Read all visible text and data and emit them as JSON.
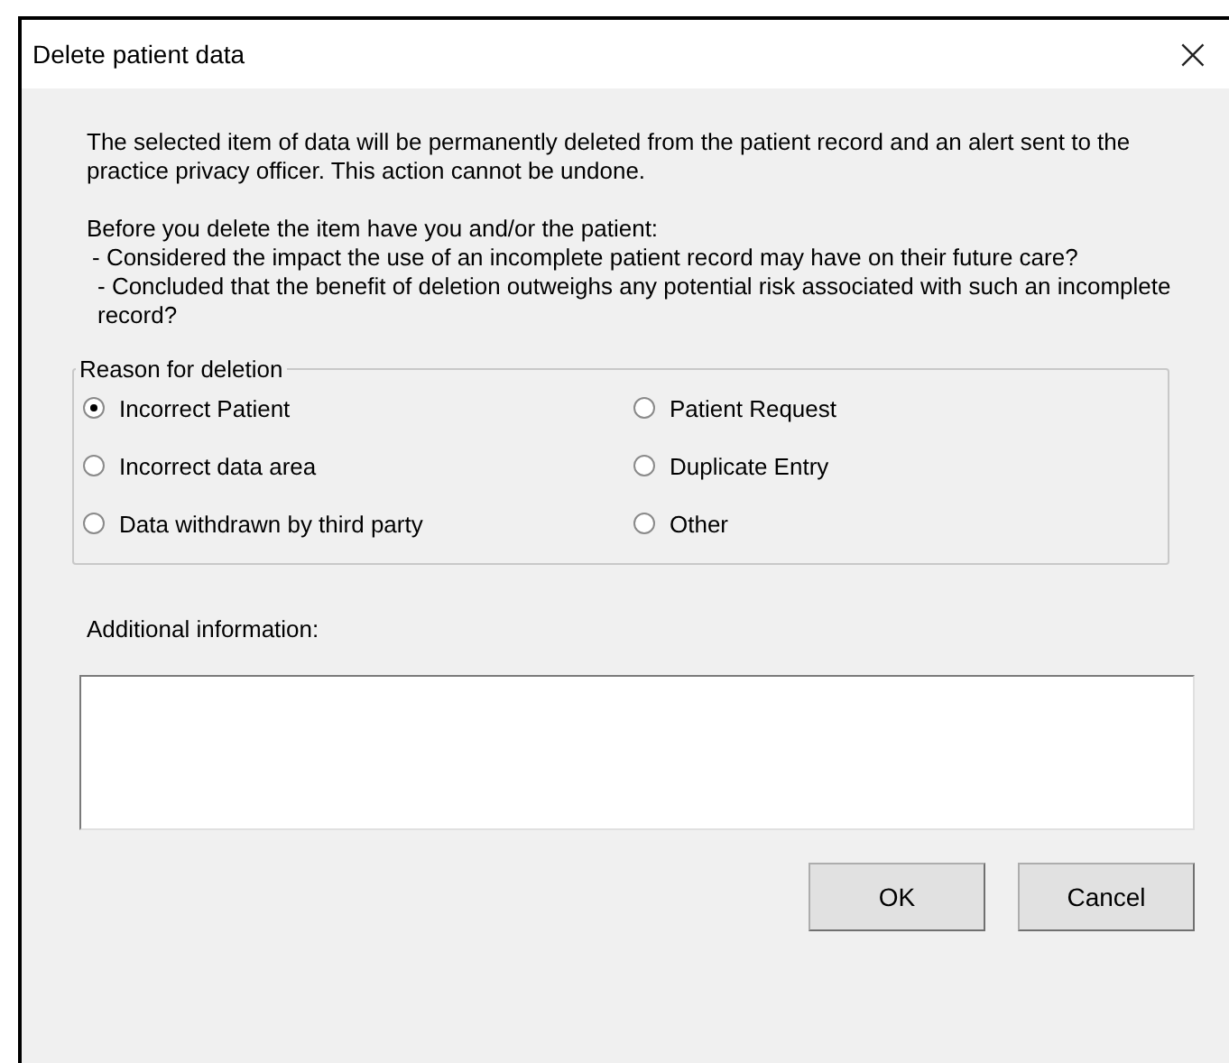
{
  "window": {
    "title": "Delete patient data",
    "close": "×"
  },
  "intro": "The selected item of data will be permanently deleted from the patient record and an alert sent to the practice privacy officer. This action cannot be undone.",
  "question": "Before you delete the item have you and/or the patient:",
  "checks": [
    "- Considered the impact the use of an incomplete patient record may have on their future care?",
    "- Concluded that the benefit of deletion outweighs any potential risk associated with such an incomplete record?"
  ],
  "reason_group": {
    "title": "Reason for deletion",
    "options": [
      {
        "label": "Incorrect Patient",
        "selected": true
      },
      {
        "label": "Patient Request",
        "selected": false
      },
      {
        "label": "Incorrect data area",
        "selected": false
      },
      {
        "label": "Duplicate Entry",
        "selected": false
      },
      {
        "label": "Data withdrawn by third party",
        "selected": false
      },
      {
        "label": "Other",
        "selected": false
      }
    ]
  },
  "additional_info": {
    "label": "Additional information:"
  },
  "buttons": [
    "OK",
    "Cancel"
  ]
}
